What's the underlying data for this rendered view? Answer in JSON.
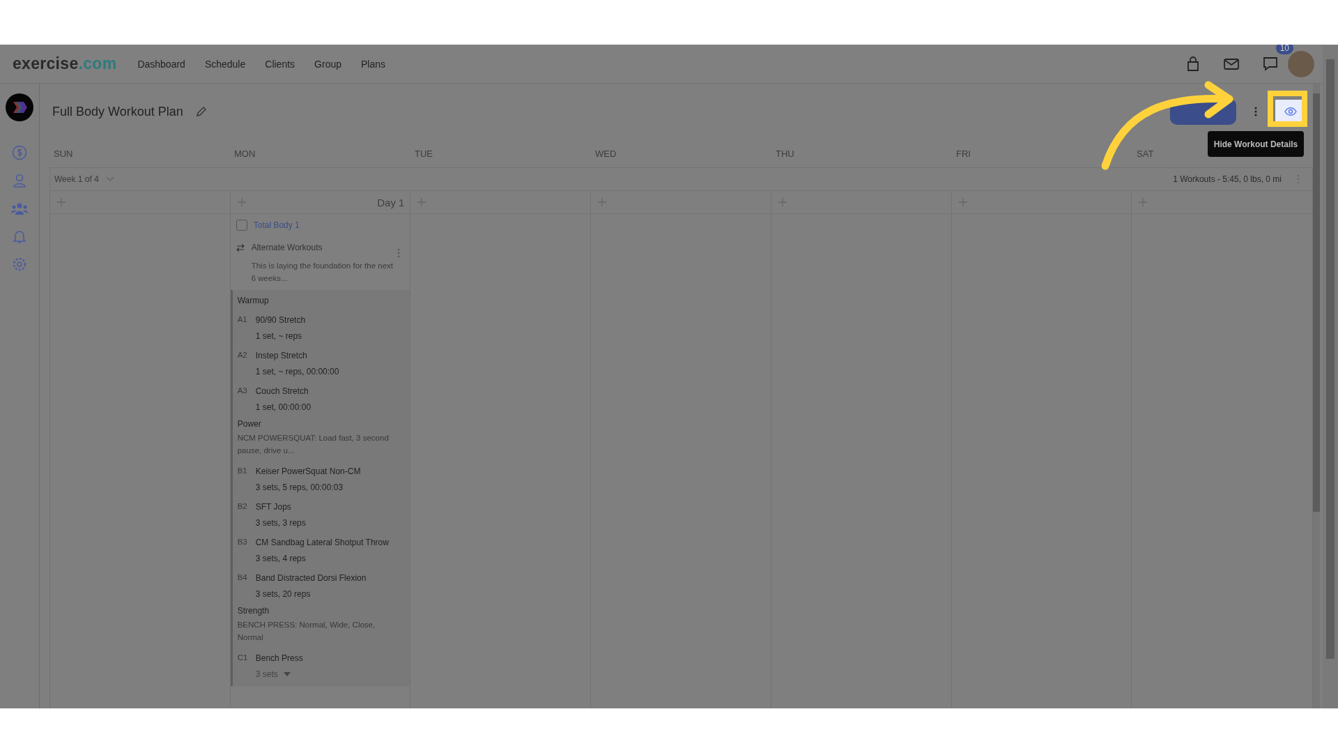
{
  "topbar": {
    "logo_main": "exercise",
    "logo_accent": ".com",
    "nav": [
      "Dashboard",
      "Schedule",
      "Clients",
      "Group",
      "Plans"
    ],
    "badge": "10"
  },
  "plan": {
    "title": "Full Body Workout Plan",
    "tooltip": "Hide Workout Details"
  },
  "calendar": {
    "days": [
      {
        "name": "SUN"
      },
      {
        "name": "MON",
        "label": "Day 1"
      },
      {
        "name": "TUE"
      },
      {
        "name": "WED"
      },
      {
        "name": "THU"
      },
      {
        "name": "FRI"
      },
      {
        "name": "SAT"
      }
    ],
    "week": "Week 1 of 4",
    "summary": "1 Workouts - 5:45, 0 lbs, 0 mi"
  },
  "workout": {
    "title": "Total Body 1",
    "checked": false,
    "alternate": "Alternate Workouts",
    "description": "This is laying the foundation for the next 6 weeks...",
    "groups": [
      {
        "name": "Warmup",
        "exercises": [
          {
            "code": "A1",
            "name": "90/90 Stretch",
            "detail": "1 set, ~ reps"
          },
          {
            "code": "A2",
            "name": "Instep Stretch",
            "detail": "1 set, ~ reps, 00:00:00"
          },
          {
            "code": "A3",
            "name": "Couch Stretch",
            "detail": "1 set, 00:00:00"
          }
        ]
      },
      {
        "name": "Power",
        "note": "NCM POWERSQUAT: Load fast, 3 second pause, drive u...",
        "exercises": [
          {
            "code": "B1",
            "name": "Keiser PowerSquat Non-CM",
            "detail": "3 sets, 5 reps, 00:00:03"
          },
          {
            "code": "B2",
            "name": "SFT Jops",
            "detail": "3 sets, 3 reps"
          },
          {
            "code": "B3",
            "name": "CM Sandbag Lateral Shotput Throw",
            "detail": "3 sets, 4 reps"
          },
          {
            "code": "B4",
            "name": "Band Distracted Dorsi Flexion",
            "detail": "3 sets, 20 reps"
          }
        ]
      },
      {
        "name": "Strength",
        "note": "BENCH PRESS: Normal, Wide, Close, Normal",
        "exercises": [
          {
            "code": "C1",
            "name": "Bench Press",
            "detail": "3 sets",
            "expandable": true
          }
        ]
      }
    ]
  }
}
